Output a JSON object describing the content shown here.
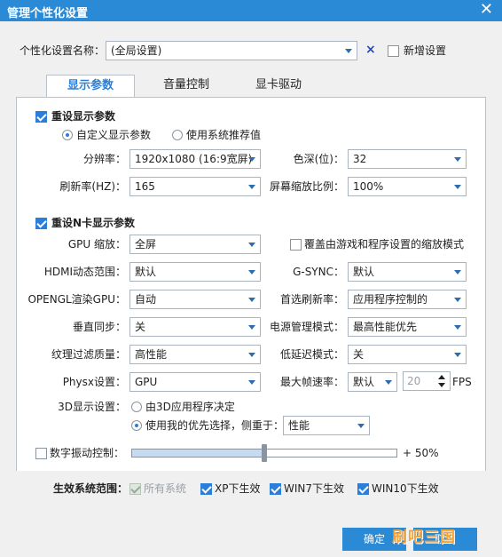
{
  "window": {
    "title": "管理个性化设置",
    "close_icon": "close-icon"
  },
  "profile": {
    "label": "个性化设置名称：",
    "value": "(全局设置)",
    "clear_glyph": "×",
    "new_label": "新增设置"
  },
  "tabs": [
    {
      "label": "显示参数"
    },
    {
      "label": "音量控制"
    },
    {
      "label": "显卡驱动"
    }
  ],
  "display": {
    "reset_label": "重设显示参数",
    "radio_custom": "自定义显示参数",
    "radio_recommended": "使用系统推荐值",
    "resolution_label": "分辨率：",
    "resolution_value": "1920x1080 (16:9宽屏)",
    "colordepth_label": "色深(位)：",
    "colordepth_value": "32",
    "refresh_label": "刷新率(HZ)：",
    "refresh_value": "165",
    "scale_label": "屏幕缩放比例：",
    "scale_value": "100%"
  },
  "nvidia": {
    "reset_label": "重设N卡显示参数",
    "gpu_scale_label": "GPU 缩放：",
    "gpu_scale_value": "全屏",
    "override_label": "覆盖由游戏和程序设置的缩放模式",
    "hdmi_label": "HDMI动态范围：",
    "hdmi_value": "默认",
    "gsync_label": "G-SYNC：",
    "gsync_value": "默认",
    "opengl_label": "OPENGL渲染GPU：",
    "opengl_value": "自动",
    "pref_refresh_label": "首选刷新率：",
    "pref_refresh_value": "应用程序控制的",
    "vsync_label": "垂直同步：",
    "vsync_value": "关",
    "power_label": "电源管理模式：",
    "power_value": "最高性能优先",
    "texture_label": "纹理过滤质量：",
    "texture_value": "高性能",
    "latency_label": "低延迟模式：",
    "latency_value": "关",
    "physx_label": "Physx设置：",
    "physx_value": "GPU",
    "maxfps_label": "最大帧速率：",
    "maxfps_value": "默认",
    "maxfps_number": "20",
    "maxfps_unit": "FPS",
    "s3d_label": "3D显示设置：",
    "s3d_radio_app": "由3D应用程序决定",
    "s3d_radio_pref": "使用我的优先选择，侧重于：",
    "s3d_pref_value": "性能"
  },
  "vibrance": {
    "label": "数字振动控制：",
    "value_text": "+ 50%",
    "level": 0.5
  },
  "scope": {
    "label": "生效系统范围：",
    "all": "所有系统",
    "xp": "XP下生效",
    "win7": "WIN7下生效",
    "win10": "WIN10下生效"
  },
  "buttons": {
    "ok": "确定",
    "cancel": "取消"
  },
  "watermark": "刷吧三国",
  "colors": {
    "accent": "#2b8ad6",
    "watermark": "#f3a33a"
  }
}
